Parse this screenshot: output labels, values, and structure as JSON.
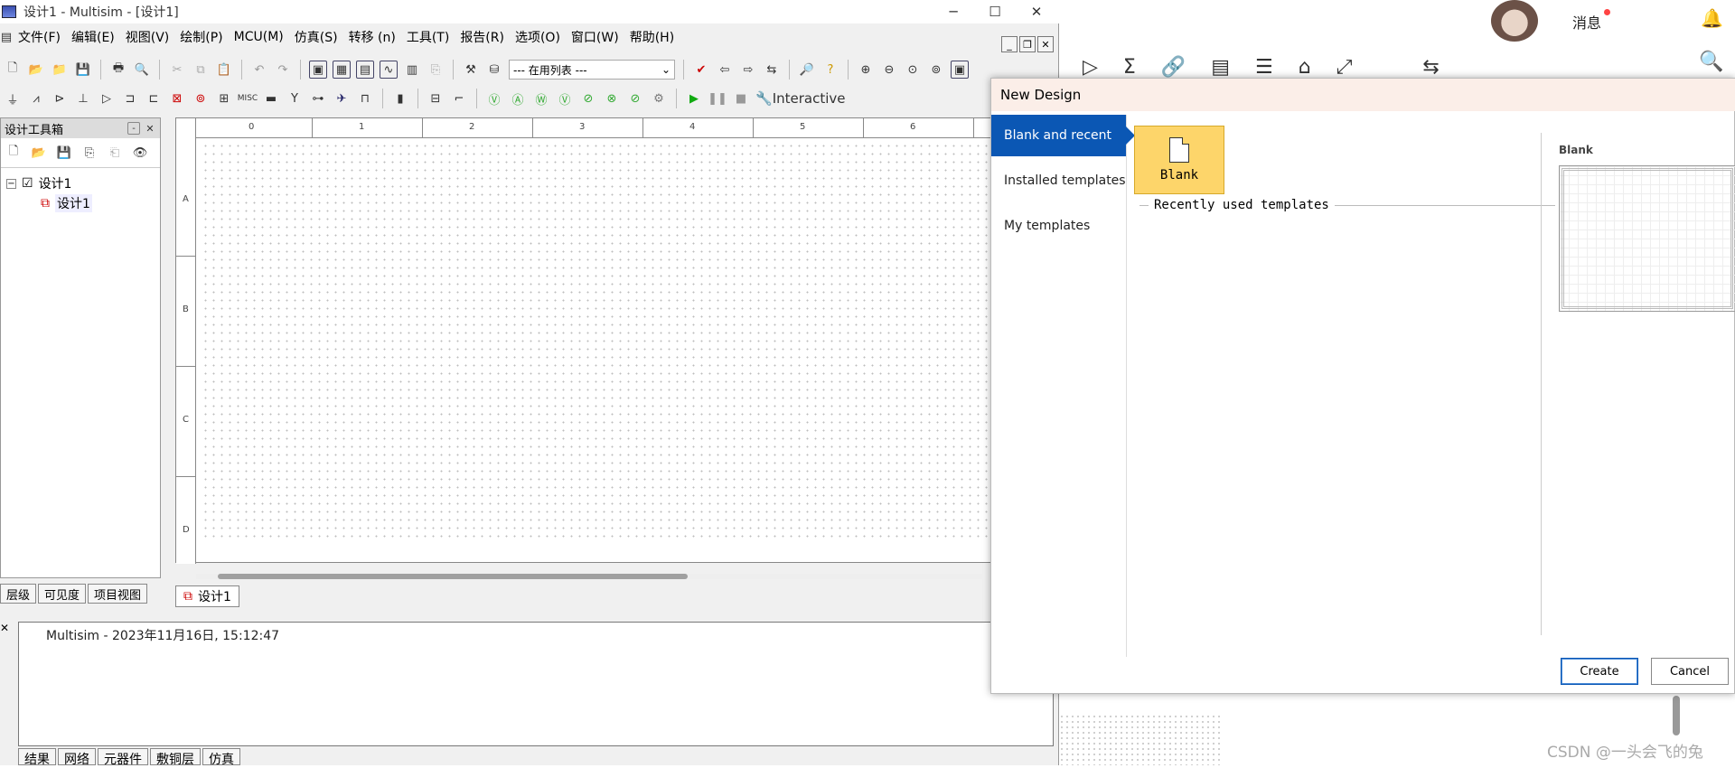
{
  "multisim": {
    "window_title": "设计1 - Multisim - [设计1]",
    "menu": [
      "文件(F)",
      "编辑(E)",
      "视图(V)",
      "绘制(P)",
      "MCU(M)",
      "仿真(S)",
      "转移 (n)",
      "工具(T)",
      "报告(R)",
      "选项(O)",
      "窗口(W)",
      "帮助(H)"
    ],
    "in_use_list": "--- 在用列表 ---",
    "sim_mode": "Interactive",
    "toolbox": {
      "title": "设计工具箱",
      "tree_root": "设计1",
      "tree_child": "设计1",
      "tabs": [
        "层级",
        "可见度",
        "项目视图"
      ]
    },
    "canvas": {
      "ruler_cols": [
        "0",
        "1",
        "2",
        "3",
        "4",
        "5",
        "6"
      ],
      "ruler_rows": [
        "A",
        "B",
        "C",
        "D"
      ],
      "tab_label": "设计1"
    },
    "output": {
      "message": "Multisim  -  2023年11月16日, 15:12:47",
      "tabs": [
        "结果",
        "网络",
        "元器件",
        "敷铜层",
        "仿真"
      ]
    }
  },
  "right_page": {
    "messages_label": "消息",
    "watermark": "CSDN @一头会飞的兔"
  },
  "dialog": {
    "title": "New Design",
    "sidebar": [
      "Blank and recent",
      "Installed templates",
      "My templates"
    ],
    "blank_tile_label": "Blank",
    "recent_label": "Recently used templates",
    "preview_title": "Blank",
    "create_label": "Create",
    "cancel_label": "Cancel"
  }
}
